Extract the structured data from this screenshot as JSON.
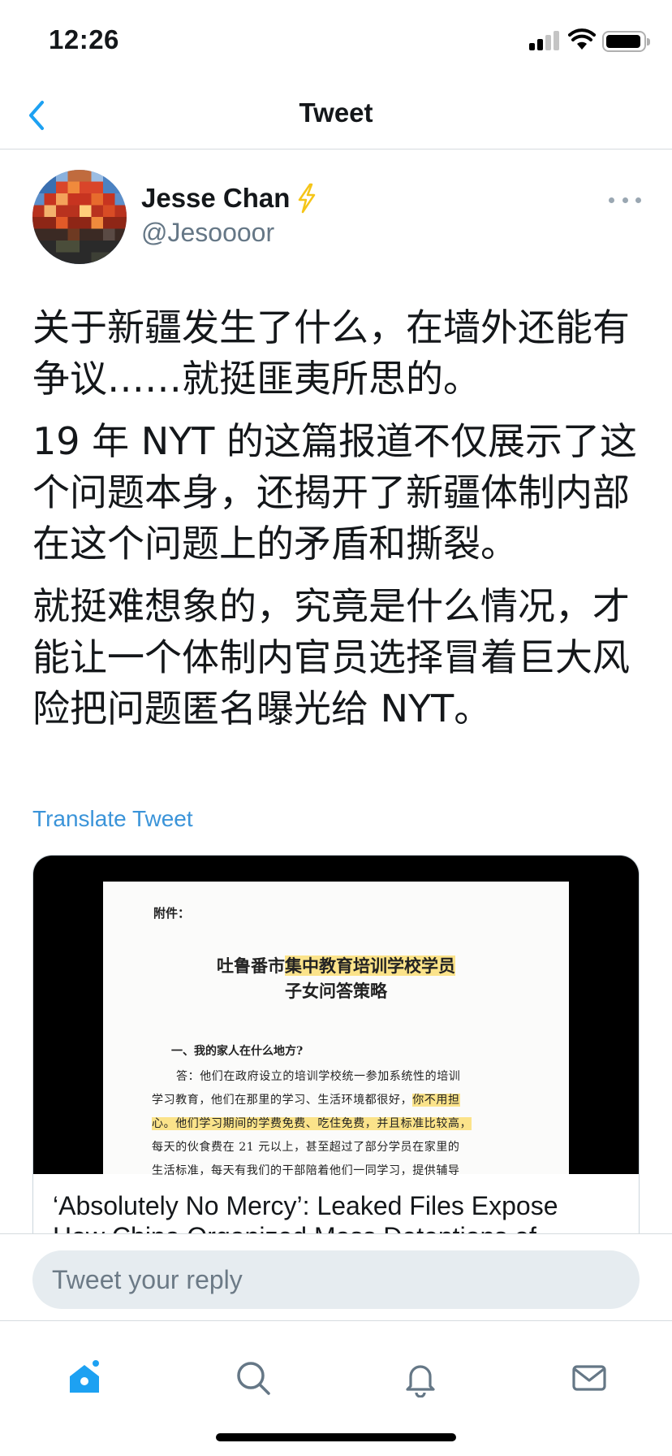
{
  "status_bar": {
    "time": "12:26"
  },
  "nav": {
    "title": "Tweet"
  },
  "author": {
    "name": "Jesse Chan",
    "handle": "@Jesoooor"
  },
  "tweet": {
    "paragraphs": [
      "关于新疆发生了什么，在墙外还能有争议……就挺匪夷所思的。",
      "19 年 NYT 的这篇报道不仅展示了这个问题本身，还揭开了新疆体制内部在这个问题上的矛盾和撕裂。",
      "就挺难想象的，究竟是什么情况，才能让一个体制内官员选择冒着巨大风险把问题匿名曝光给 NYT。"
    ],
    "translate_label": "Translate Tweet"
  },
  "card": {
    "doc": {
      "attachment": "附件：",
      "title_line1_prefix": "吐鲁番市",
      "title_line1_highlight": "集中教育培训学校学员",
      "title_line2": "子女问答策略",
      "heading": "一、我的家人在什么地方?",
      "line1": "答：他们在政府设立的培训学校统一参加系统性的培训",
      "line2_plain": "学习教育，他们在那里的学习、生活环境都很好，",
      "line2_highlight": "你不用担",
      "line3_highlight": "心。他们学习期间的学费免费、吃住免费，并且标准比较高，",
      "line4": "每天的伙食费在 21 元以上，甚至超过了部分学员在家里的",
      "line5": "生活标准，每天有我们的干部陪着他们一同学习，提供辅导"
    },
    "headline": "‘Absolutely No Mercy’: Leaked Files Expose",
    "headline_cont": "How China Organized Mass Detentions of"
  },
  "reply": {
    "placeholder": "Tweet your reply"
  },
  "tabs": [
    "home-icon",
    "search-icon",
    "notifications-icon",
    "messages-icon"
  ],
  "colors": {
    "accent": "#1da1f2",
    "link": "#3b94d9",
    "highlight": "#fbe38a",
    "verified_bolt": "#f5c518"
  }
}
